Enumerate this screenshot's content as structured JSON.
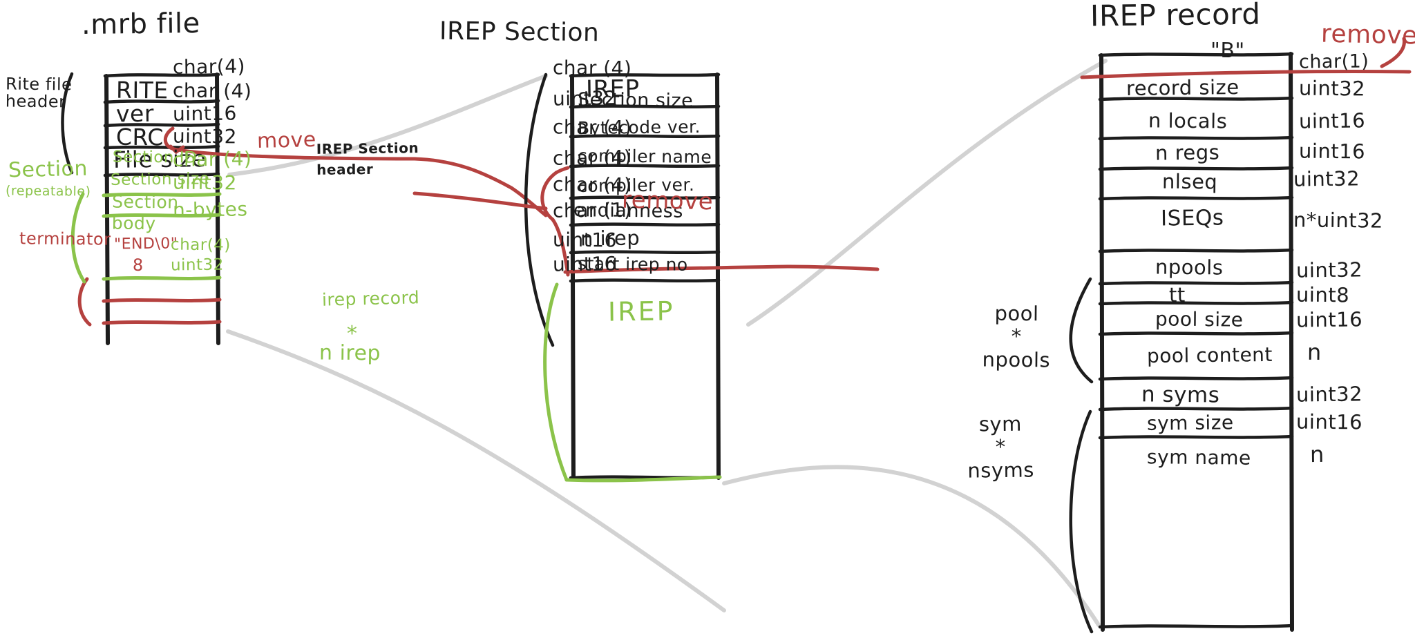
{
  "palette": {
    "black": "#1d1d1d",
    "green": "#8bc34a",
    "red": "#b5413f",
    "grey": "#cdcdcd",
    "background": "#ffffff"
  },
  "diagram": {
    "kind": "hand-drawn whiteboard sketch",
    "subject": "mruby .mrb binary file format layout"
  },
  "mrb_file": {
    "title": ".mrb file",
    "brace_labels": {
      "rite_header": "Rite file\nheader",
      "section": "Section",
      "section_note": "(repeatable)",
      "terminator": "terminator"
    },
    "rows": [
      {
        "name": "RITE",
        "type": "char(4)",
        "color": "black"
      },
      {
        "name": "ver",
        "type": "char (4)",
        "color": "black"
      },
      {
        "name": "CRC",
        "type": "uint16",
        "color": "black"
      },
      {
        "name": "File size",
        "type": "uint32",
        "color": "black"
      },
      {
        "name": "Section ID",
        "type": "char (4)",
        "color": "green"
      },
      {
        "name": "Section size",
        "type": "uint32",
        "color": "green"
      },
      {
        "name": "Section body",
        "type": "n-bytes",
        "color": "green"
      },
      {
        "name": "\"END\\0\"",
        "type": "char(4)",
        "color": "red"
      },
      {
        "name": "8",
        "type": "uint32",
        "color": "red"
      }
    ],
    "annotations": [
      {
        "text": "move",
        "color": "red"
      }
    ]
  },
  "irep_section": {
    "title": "IREP Section",
    "header_label": "IREP Section\nheader",
    "rows": [
      {
        "name": "IREP",
        "type": "char (4)",
        "color": "black"
      },
      {
        "name": "Section size",
        "type": "uint32",
        "color": "black"
      },
      {
        "name": "Bytecode ver.",
        "type": "char (4)",
        "color": "black"
      },
      {
        "name": "compiler name",
        "type": "char (4)",
        "color": "black"
      },
      {
        "name": "compiler ver.",
        "type": "char (4)",
        "color": "black"
      },
      {
        "name": "endianness",
        "type": "char (1)",
        "color": "black",
        "struck": true
      },
      {
        "name": "n irep",
        "type": "uint16",
        "color": "black"
      },
      {
        "name": "start irep no",
        "type": "uint16",
        "color": "black"
      },
      {
        "name": "IREP",
        "type": "",
        "color": "green"
      }
    ],
    "annotations": [
      {
        "text": "remove",
        "color": "red"
      },
      {
        "text": "irep record",
        "color": "green"
      },
      {
        "text": "*",
        "color": "green"
      },
      {
        "text": "n irep",
        "color": "green"
      }
    ]
  },
  "irep_record": {
    "title": "IREP record",
    "rows": [
      {
        "name": "\"B\"",
        "type": "char(1)",
        "struck": true
      },
      {
        "name": "record size",
        "type": "uint32"
      },
      {
        "name": "n locals",
        "type": "uint16"
      },
      {
        "name": "n regs",
        "type": "uint16"
      },
      {
        "name": "nlseq",
        "type": "uint32"
      },
      {
        "name": "ISEQs",
        "type": "n*uint32"
      },
      {
        "name": "npools",
        "type": "uint32"
      },
      {
        "name": "tt",
        "type": "uint8"
      },
      {
        "name": "pool size",
        "type": "uint16"
      },
      {
        "name": "pool content",
        "type": "n"
      },
      {
        "name": "n syms",
        "type": "uint32"
      },
      {
        "name": "sym size",
        "type": "uint16"
      },
      {
        "name": "sym name",
        "type": "n"
      }
    ],
    "brace_labels": {
      "pool": "pool\n*\nnpools",
      "sym": "sym\n*\nnsyms"
    },
    "annotations": [
      {
        "text": "remove",
        "color": "red"
      }
    ]
  }
}
